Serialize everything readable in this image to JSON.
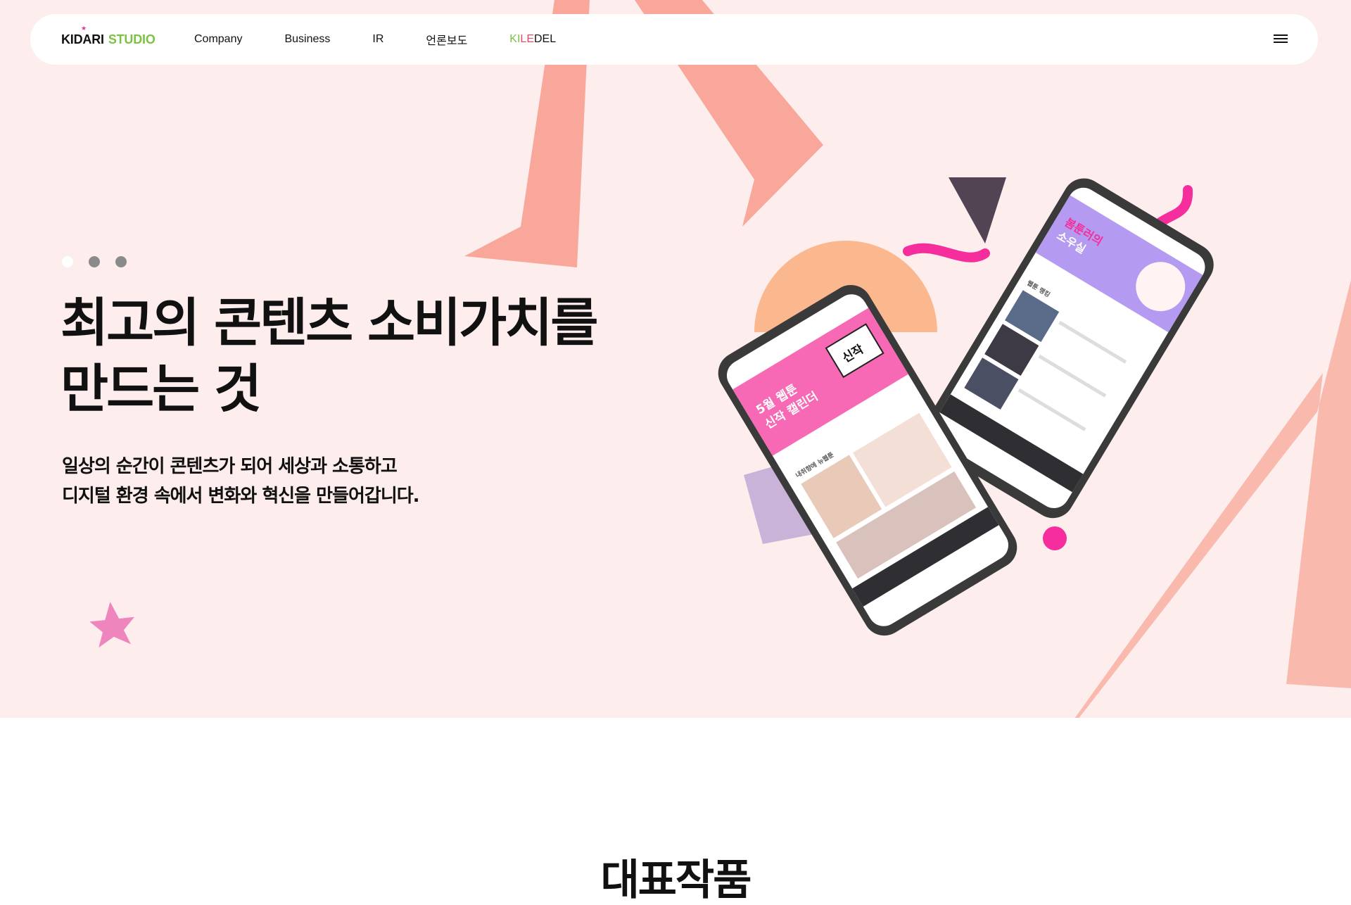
{
  "brand": {
    "logo_main": "KIDARI",
    "logo_sub": "STUDIO",
    "logo_star": "★"
  },
  "nav": {
    "items": [
      {
        "label": "Company"
      },
      {
        "label": "Business"
      },
      {
        "label": "IR"
      },
      {
        "label": "언론보도"
      }
    ],
    "kiledel": {
      "part1": "KI",
      "part2": "LE",
      "part3": "DEL"
    },
    "menu_icon": "hamburger-icon"
  },
  "hero": {
    "slide_indicator": {
      "total": 3,
      "active": 1
    },
    "headline_line1": "최고의 콘텐츠 소비가치를",
    "headline_line2": "만드는 것",
    "sub_line1": "일상의 순간이 콘텐츠가 되어 세상과 소통하고",
    "sub_line2": "디지털 환경 속에서 변화와 혁신을 만들어갑니다.",
    "phone_front": {
      "banner_line1": "5월 웹툰",
      "banner_line2": "신작 캘린더",
      "badge": "신작",
      "section": "내취향에 뉴웹툰"
    },
    "phone_back": {
      "banner_line1": "봄툰러의",
      "banner_line2": "소우실",
      "section": "웹툰 랭킹"
    }
  },
  "section": {
    "title": "대표작품"
  },
  "colors": {
    "hero_bg": "#fdeeed",
    "salmon": "#f9a79a",
    "peach": "#fbb88f",
    "pink_accent": "#f62e9d",
    "lilac": "#c9b3d9",
    "dark_triangle": "#524452",
    "green": "#7dc242"
  }
}
